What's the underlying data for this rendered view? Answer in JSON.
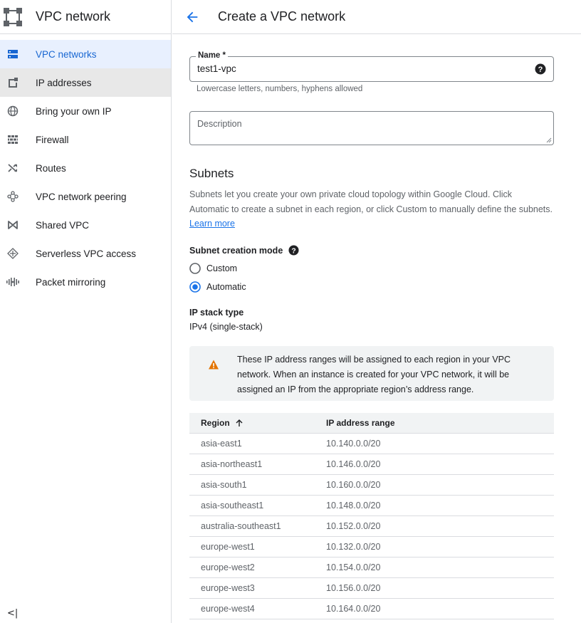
{
  "sidebar": {
    "title": "VPC network",
    "logo_icon": "vpc-network-logo",
    "items": [
      {
        "label": "VPC networks",
        "icon": "vpc-networks-icon",
        "state": "active"
      },
      {
        "label": "IP addresses",
        "icon": "ip-addresses-icon",
        "state": "hover"
      },
      {
        "label": "Bring your own IP",
        "icon": "globe-icon",
        "state": ""
      },
      {
        "label": "Firewall",
        "icon": "firewall-icon",
        "state": ""
      },
      {
        "label": "Routes",
        "icon": "routes-icon",
        "state": ""
      },
      {
        "label": "VPC network peering",
        "icon": "peering-icon",
        "state": ""
      },
      {
        "label": "Shared VPC",
        "icon": "shared-vpc-icon",
        "state": ""
      },
      {
        "label": "Serverless VPC access",
        "icon": "serverless-icon",
        "state": ""
      },
      {
        "label": "Packet mirroring",
        "icon": "packet-mirroring-icon",
        "state": ""
      }
    ],
    "collapse_glyph": "<|"
  },
  "header": {
    "title": "Create a VPC network"
  },
  "form": {
    "name_label": "Name *",
    "name_value": "test1-vpc",
    "name_hint": "Lowercase letters, numbers, hyphens allowed",
    "description_placeholder": "Description"
  },
  "subnets": {
    "title": "Subnets",
    "description": "Subnets let you create your own private cloud topology within Google Cloud. Click Automatic to create a subnet in each region, or click Custom to manually define the subnets.",
    "learn_more": "Learn more",
    "mode_label": "Subnet creation mode",
    "mode_options": [
      {
        "label": "Custom",
        "selected": false
      },
      {
        "label": "Automatic",
        "selected": true
      }
    ],
    "stack_label": "IP stack type",
    "stack_value": "IPv4 (single-stack)",
    "callout": "These IP address ranges will be assigned to each region in your VPC network. When an instance is created for your VPC network, it will be assigned an IP from the appropriate region’s address range."
  },
  "table": {
    "columns": [
      "Region",
      "IP address range"
    ],
    "rows": [
      [
        "asia-east1",
        "10.140.0.0/20"
      ],
      [
        "asia-northeast1",
        "10.146.0.0/20"
      ],
      [
        "asia-south1",
        "10.160.0.0/20"
      ],
      [
        "asia-southeast1",
        "10.148.0.0/20"
      ],
      [
        "australia-southeast1",
        "10.152.0.0/20"
      ],
      [
        "europe-west1",
        "10.132.0.0/20"
      ],
      [
        "europe-west2",
        "10.154.0.0/20"
      ],
      [
        "europe-west3",
        "10.156.0.0/20"
      ],
      [
        "europe-west4",
        "10.164.0.0/20"
      ]
    ]
  },
  "colors": {
    "accent": "#1a73e8",
    "active_bg": "#e8f0fe",
    "warning": "#e37400"
  }
}
